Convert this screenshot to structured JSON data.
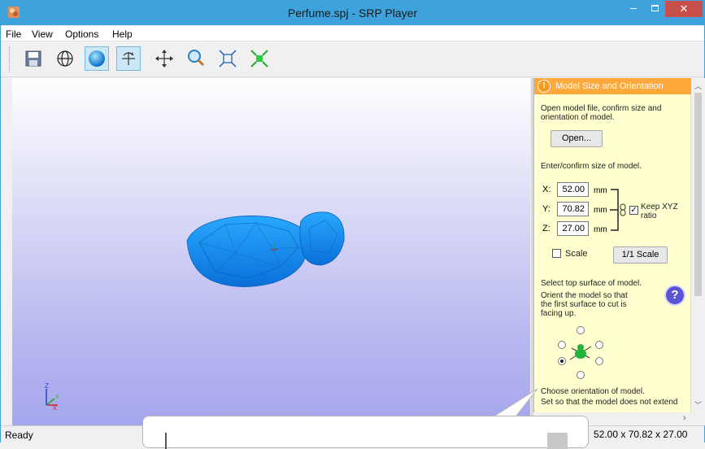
{
  "window": {
    "title": "Perfume.spj - SRP Player",
    "controls": {
      "minimize": "–",
      "close": "✕"
    }
  },
  "menu": [
    "File",
    "View",
    "Options",
    "Help"
  ],
  "toolbar": {
    "buttons": [
      "save-icon",
      "globe-icon",
      "sphere-icon",
      "rotate-icon",
      "pan-icon",
      "zoom-icon",
      "fit-icon",
      "center-icon"
    ],
    "pressed": [
      "sphere-icon",
      "rotate-icon"
    ]
  },
  "panel": {
    "header": "Model Size and Orientation",
    "header_icon": "!",
    "open_instruction": "Open model file, confirm size and orientation of model.",
    "open_button": "Open...",
    "size_instruction": "Enter/confirm size of model.",
    "x_label": "X:",
    "y_label": "Y:",
    "z_label": "Z:",
    "x_value": "52.00",
    "y_value": "70.82",
    "z_value": "27.00",
    "unit": "mm",
    "keep_ratio_label": "Keep XYZ ratio",
    "keep_ratio_checked": true,
    "scale_label": "Scale",
    "scale_checked": false,
    "one_to_one_button": "1/1 Scale",
    "top_surface_title": "Select top surface of model.",
    "top_surface_instruction": "Orient the model so that the first surface to cut is facing up.",
    "help_icon": "?",
    "orientation_text_1": "Choose orientation of model.",
    "orientation_text_2": "Set so that the model does not extend"
  },
  "status": {
    "text": "Ready",
    "dimensions": "52.00 x 70.82 x 27.00"
  },
  "colors": {
    "titlebar": "#3ea3dc",
    "close": "#c7504b",
    "panel_header": "#ffa83c",
    "panel_bg": "#ffffcf",
    "model": "#1e90ff"
  }
}
